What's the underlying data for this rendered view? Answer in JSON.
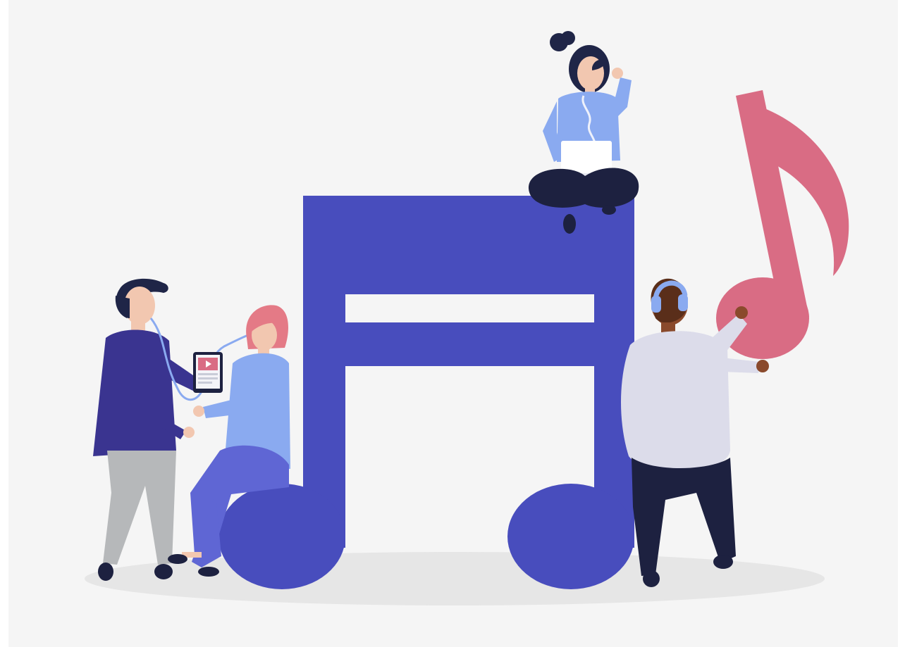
{
  "illustration": {
    "subject": "people-listening-to-music",
    "colors": {
      "background": "#f5f5f5",
      "ground_shadow": "#e6e6e6",
      "big_note": "#484dbd",
      "pink_note": "#d96c84",
      "skin": "#f2c7b0",
      "dark_hair": "#1f2547",
      "pink_hair": "#e47a86",
      "navy_shirt": "#3a3490",
      "light_blue": "#8aaaf0",
      "purple_blue": "#5f66d4",
      "grey_pants": "#b6b8ba",
      "lavender_shirt": "#dcdcea",
      "dark_navy": "#1d2140",
      "brown_skin": "#8a4a2c"
    },
    "icons": [
      "big-beamed-eighth-notes",
      "pink-eighth-note",
      "tablet-play-icon",
      "headphones-icon",
      "laptop"
    ]
  }
}
